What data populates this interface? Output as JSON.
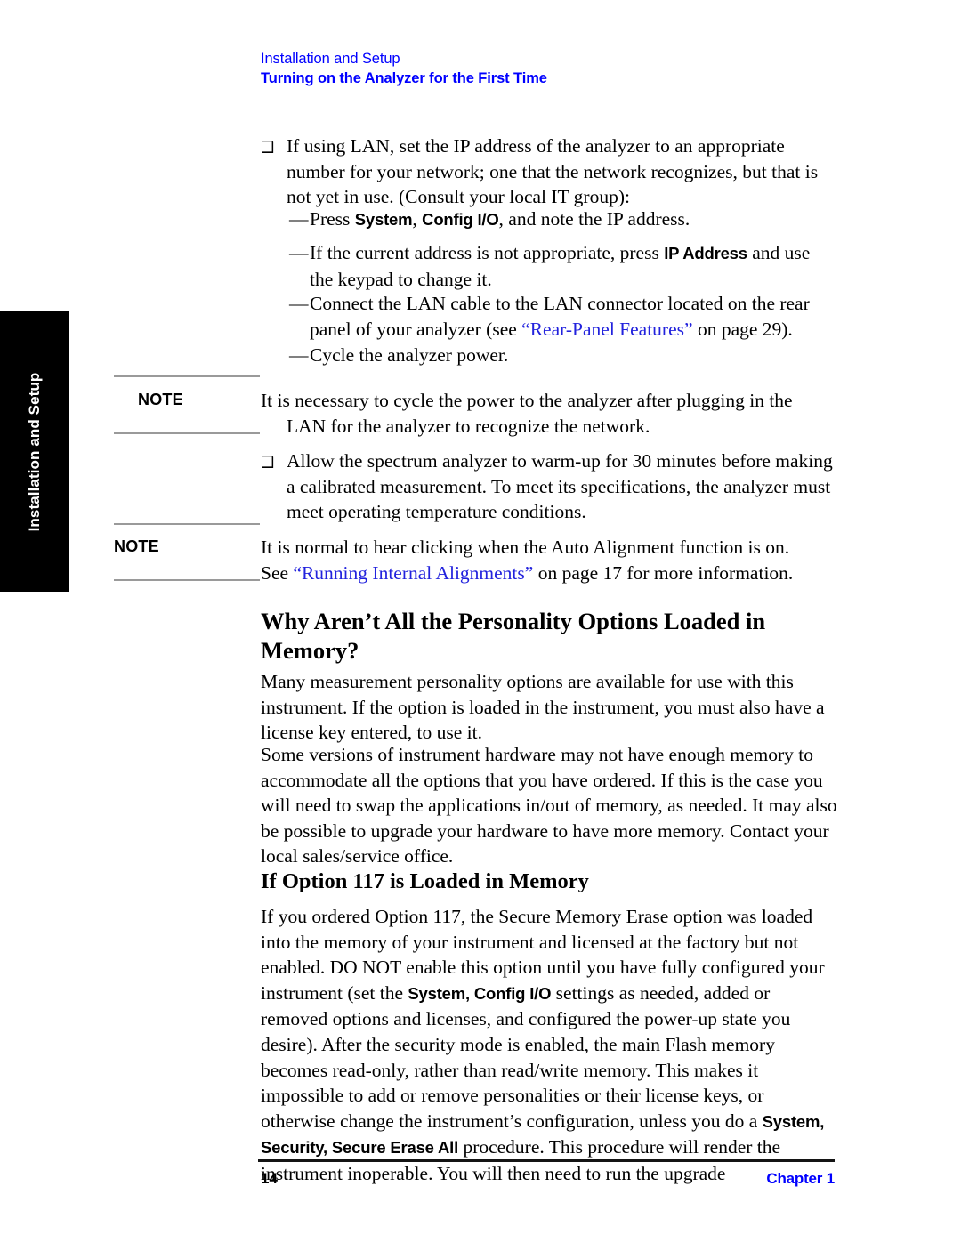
{
  "header": {
    "chapter_title": "Installation and Setup",
    "section_title": "Turning on the Analyzer for the First Time"
  },
  "edge_tab": {
    "label": "Installation and Setup"
  },
  "body": {
    "bullet_marker": "❑",
    "dash_marker": "—",
    "bullet_lan": {
      "text": "If using LAN, set the IP address of the analyzer to an appropriate number for your network; one that the network recognizes, but that is not yet in use. (Consult your local IT group):"
    },
    "dash_press_system": {
      "pre": "Press ",
      "key1": "System",
      "mid1": ", ",
      "key2": "Config I/O",
      "post": ", and note the IP address."
    },
    "dash_ip_address": {
      "pre": "If the current address is not appropriate, press ",
      "key1": "IP Address",
      "post": " and use the keypad to change it."
    },
    "dash_lan_cable": {
      "pre": "Connect the LAN cable to the LAN connector located on the rear panel of your analyzer (see ",
      "xref": "“Rear-Panel Features”",
      "post": " on page 29)."
    },
    "dash_cycle_power": {
      "text": "Cycle the analyzer power."
    },
    "bullet_warmup": {
      "text": "Allow the spectrum analyzer to warm-up for 30 minutes before making a calibrated measurement. To meet its specifications, the analyzer must meet operating temperature conditions."
    }
  },
  "notes": [
    {
      "label": "NOTE",
      "line1": "It is necessary to cycle the power to the analyzer after plugging in the",
      "line2": "LAN for the analyzer to recognize the network."
    },
    {
      "label": "NOTE",
      "line1": "It is normal to hear clicking when the Auto Alignment function is on.",
      "line2_pre": "See ",
      "line2_xref": "“Running Internal Alignments”",
      "line2_post": " on page 17 for more information."
    }
  ],
  "sections": {
    "personality": {
      "heading": "Why Aren’t All the Personality Options Loaded in Memory?",
      "para1": "Many measurement personality options are available for use with this instrument. If the option is loaded in the instrument, you must also have a license key entered, to use it.",
      "para2": "Some versions of instrument hardware may not have enough memory to accommodate all the options that you have ordered. If this is the case you will need to swap the applications in/out of memory, as needed. It may also be possible to upgrade your hardware to have more memory. Contact your local sales/service office."
    },
    "option117": {
      "heading": "If Option 117 is Loaded in Memory",
      "para_part1": "If you ordered Option 117, the Secure Memory Erase option was loaded into the memory of your instrument and licensed at the factory but not enabled. DO NOT enable this option until you have fully configured your instrument (set the ",
      "key1": "System, Config I/O",
      "para_part2": " settings as needed, added or removed options and licenses, and configured the power-up state you desire). After the security mode is enabled, the main Flash memory becomes read-only, rather than read/write memory. This makes it impossible to add or remove personalities or their license keys, or otherwise change the instrument’s configuration, unless you do a ",
      "key2": "System, Security, Secure Erase All",
      "para_part3": " procedure. This procedure will render the instrument inoperable. You will then need to run the upgrade"
    }
  },
  "footer": {
    "page_number": "14",
    "chapter_label": "Chapter 1"
  },
  "colors": {
    "link_blue": "#0000ff",
    "xref_blue": "#2222dd",
    "note_rule": "#9a9a9a",
    "tab_background": "#000000"
  }
}
